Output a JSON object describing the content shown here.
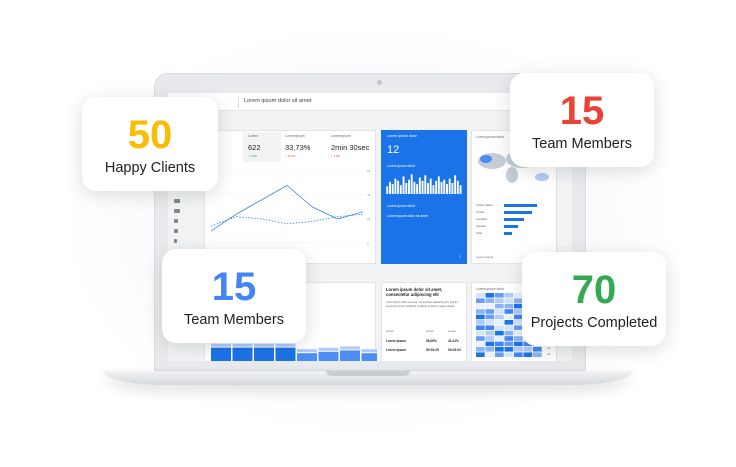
{
  "stats": [
    {
      "value": "50",
      "label": "Happy Clients",
      "color": "#fbbc04"
    },
    {
      "value": "15",
      "label": "Team Members",
      "color": "#ea4335"
    },
    {
      "value": "15",
      "label": "Team Members",
      "color": "#4285f4"
    },
    {
      "value": "70",
      "label": "Projects Completed",
      "color": "#34a853"
    }
  ],
  "dashboard": {
    "title": "Lorem ipsum dolor sit amet",
    "section_label": "all",
    "metrics": [
      {
        "label": "",
        "value": "22",
        "delta": "2.2%"
      },
      {
        "label": "Lorem",
        "value": "622",
        "delta": "↑ 6.8%"
      },
      {
        "label": "Lorem ipsum",
        "value": "33,73%",
        "delta": "↑ 11.2%"
      },
      {
        "label": "Lorem ipsum",
        "value": "2min 30sec",
        "delta": "↑ 3.2%"
      }
    ],
    "blue_card": {
      "title": "Lorem ipsum dolor",
      "value": "12",
      "subtitle": "Lorem ipsum dolor",
      "link1": "Lorem ipsum dolor",
      "link2": "Lorem ipsum dolor sit amet"
    },
    "map_card": {
      "title": "Lorem ipsum dolor",
      "countries": [
        "United States",
        "Jordan",
        "Australia",
        "Canada",
        "India"
      ],
      "country_values": [
        0.65,
        0.55,
        0.4,
        0.28,
        0.15
      ],
      "footer": "Lorem ipsum"
    },
    "text_card": {
      "title": "Lorem ipsum dolor sit amet, consectetur adipiscing elit",
      "body": "Lorem ipsum dolor sit amet, consectetur adipiscing elit, sed do eiusmod tempor incididunt ut labore et dolore magna aliqua.",
      "headers": [
        "Lorem",
        "Lorem",
        "Lorem"
      ],
      "rows": [
        [
          "Lorem ipsum",
          "56,06%",
          "41.41%"
        ],
        [
          "Lorem ipsum",
          "50:03:29",
          "03:03:04"
        ]
      ]
    },
    "heat_card": {
      "title": "Lorem ipsum dolor",
      "side_labels": [
        "am",
        "pm",
        "am"
      ]
    }
  },
  "line_chart": {
    "type": "line",
    "y_ticks": [
      "60",
      "40",
      "20",
      "0"
    ],
    "series": [
      {
        "values": [
          10,
          24,
          36,
          48,
          30,
          20,
          26
        ]
      },
      {
        "values": [
          14,
          22,
          20,
          16,
          18,
          22,
          24
        ]
      }
    ]
  },
  "mini_bars": [
    0.35,
    0.55,
    0.45,
    0.7,
    0.6,
    0.4,
    0.8,
    0.5,
    0.65,
    0.9,
    0.55,
    0.45,
    0.75,
    0.6,
    0.85,
    0.5,
    0.7,
    0.4,
    0.6,
    0.8,
    0.55,
    0.65,
    0.45,
    0.7,
    0.5,
    0.85,
    0.6,
    0.4
  ],
  "bottom_bars": [
    0.55,
    0.55,
    0.55,
    0.55,
    0.35,
    0.4,
    0.45,
    0.35
  ]
}
